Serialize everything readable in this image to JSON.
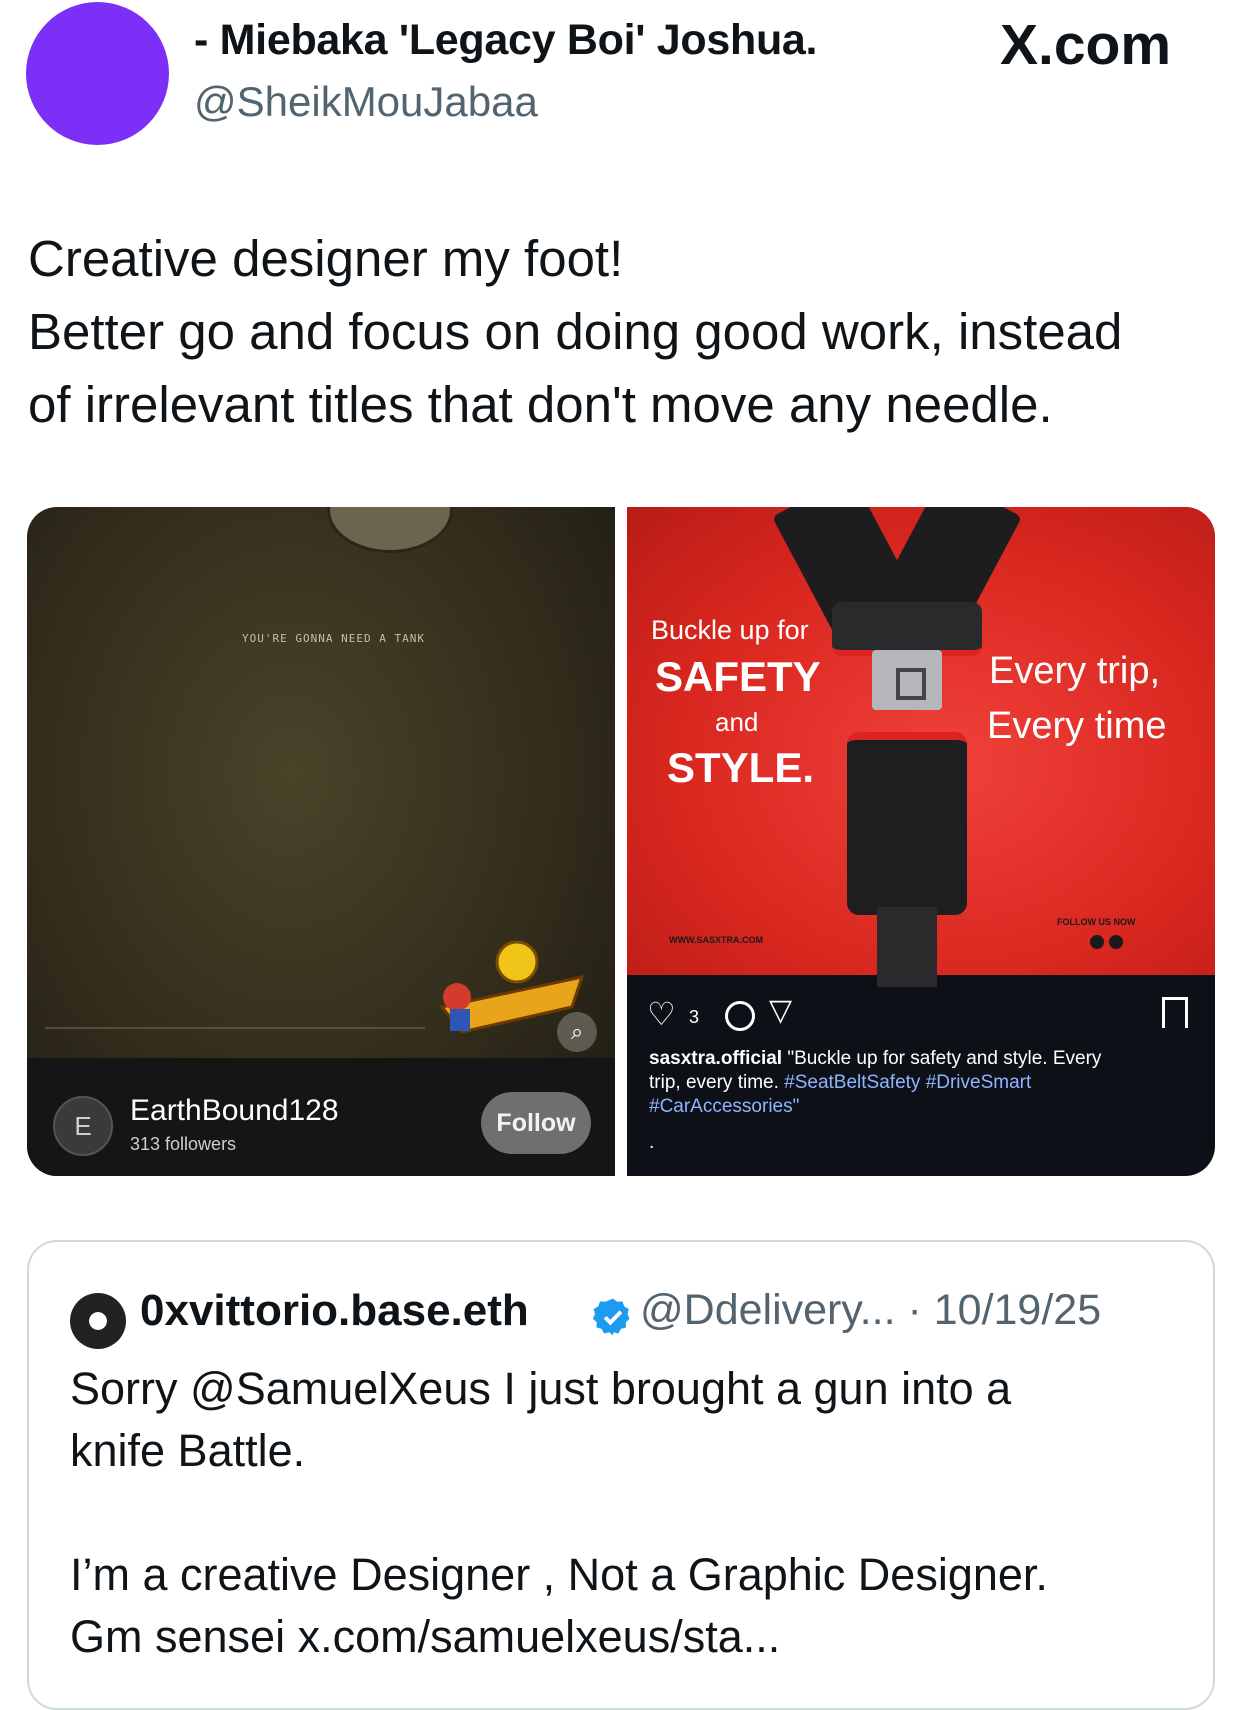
{
  "post": {
    "display_name": "- Miebaka 'Legacy Boi' Joshua.",
    "handle": "@SheikMouJabaa",
    "brand": "X.com",
    "text_lines": [
      "Creative designer my foot!",
      "Better go and focus on doing good work, instead",
      "of irrelevant titles that don't move any needle."
    ]
  },
  "media_left": {
    "art_caption": "YOU'RE GONNA NEED A TANK",
    "username": "EarthBound128",
    "followers": "313 followers",
    "badge_letter": "E",
    "follow_label": "Follow"
  },
  "media_right": {
    "ad_line1": "Buckle up for",
    "ad_line2": "SAFETY",
    "ad_line3": "and",
    "ad_line4": "STYLE.",
    "ad_right1": "Every trip,",
    "ad_right2": "Every time",
    "ad_url": "WWW.SASXTRA.COM",
    "ad_follow": "FOLLOW US NOW",
    "like_count": "3",
    "caption_user": "sasxtra.official",
    "caption_text": "\"Buckle up for safety and style. Every",
    "caption_line2": "trip, every time.",
    "caption_tags2": "#SeatBeltSafety #DriveSmart",
    "caption_tags3": "#CarAccessories\"",
    "caption_dot": "."
  },
  "quote": {
    "name": "0xvittorio.base.eth",
    "handle_date": "@Ddelivery... · 10/19/25",
    "text_lines": [
      "Sorry @SamuelXeus  I just brought a gun into a",
      "knife Battle.",
      "",
      "I’m a creative Designer , Not a Graphic Designer.",
      "Gm sensei x.com/samuelxeus/sta..."
    ]
  },
  "colors": {
    "avatar": "#7b2ff7",
    "verified": "#1d9bf0",
    "link": "#1d9bf0",
    "muted": "#536471"
  }
}
